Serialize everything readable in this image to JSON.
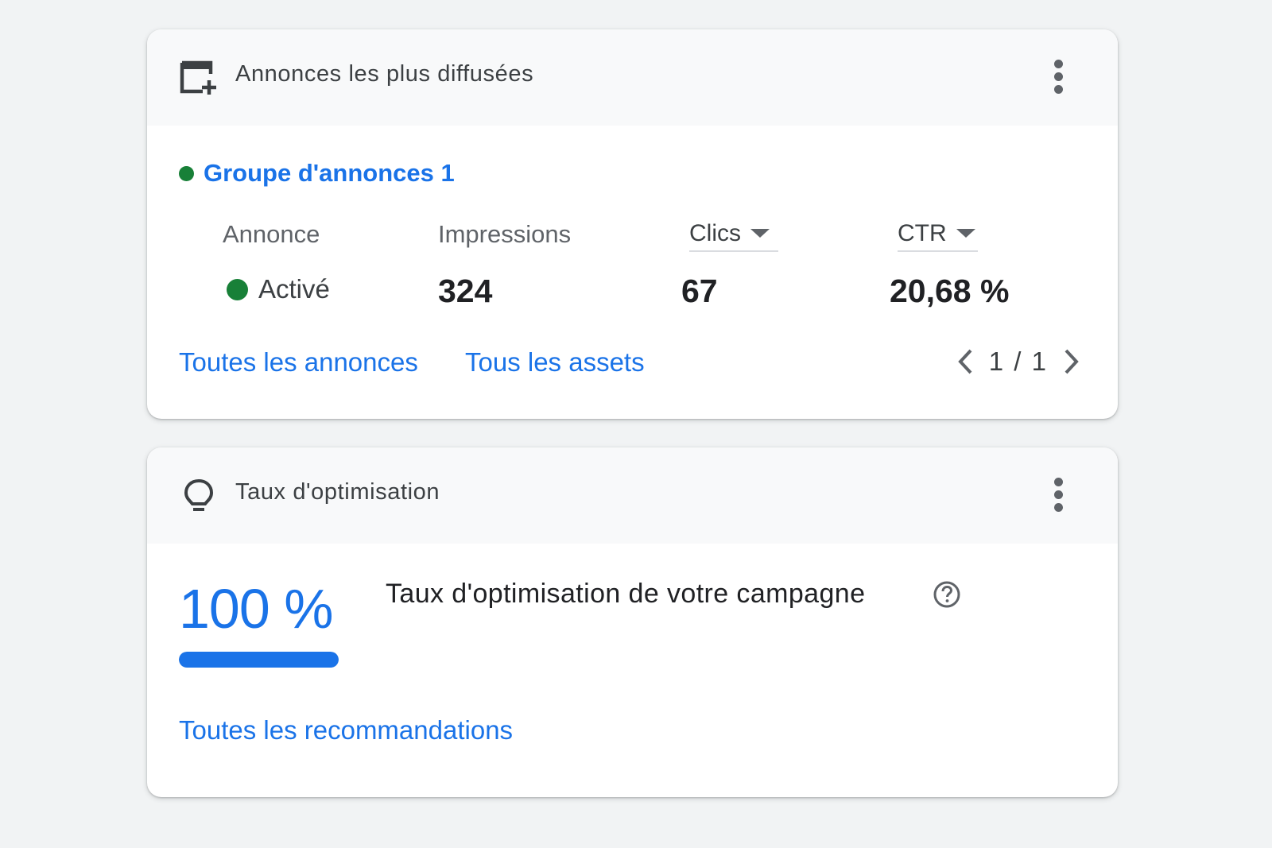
{
  "ads_card": {
    "title": "Annonces les plus diffusées",
    "header_icon": "ad-window-add-icon",
    "menu_icon": "more-vert-icon",
    "ad_group": {
      "label": "Groupe d'annonces 1",
      "status_color": "#188038"
    },
    "columns": {
      "ad": "Annonce",
      "impressions": "Impressions",
      "clicks": "Clics",
      "ctr": "CTR"
    },
    "row": {
      "status": "Activé",
      "status_color": "#188038",
      "impressions": "324",
      "clicks": "67",
      "ctr": "20,68 %"
    },
    "links": {
      "all_ads": "Toutes les annonces",
      "all_assets": "Tous les assets"
    },
    "pager": {
      "text": "1 / 1",
      "prev_icon": "chevron-left-icon",
      "next_icon": "chevron-right-icon"
    }
  },
  "optimization_card": {
    "title": "Taux d'optimisation",
    "header_icon": "lightbulb-icon",
    "menu_icon": "more-vert-icon",
    "score": "100 %",
    "score_fraction": 1.0,
    "description": "Taux d'optimisation de votre campagne",
    "help_icon": "help-circle-icon",
    "link": "Toutes les recommandations"
  },
  "colors": {
    "accent": "#1a73e8",
    "status_active": "#188038",
    "background": "#f1f3f4"
  }
}
